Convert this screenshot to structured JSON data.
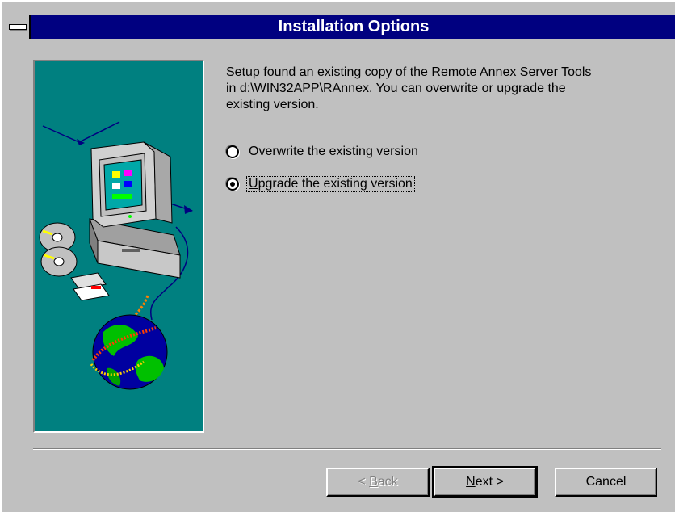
{
  "window": {
    "title": "Installation Options",
    "system_menu_icon": "system-menu-icon"
  },
  "illustration": {
    "icons": [
      "computer-icon",
      "cd-disc-icon",
      "floppy-disk-icon",
      "globe-icon",
      "network-cable-icon"
    ]
  },
  "message": {
    "line1": "Setup found an existing copy of the Remote Annex Server Tools",
    "line2": "in d:\\WIN32APP\\RAnnex. You can overwrite or upgrade the",
    "line3": "existing version."
  },
  "options": {
    "overwrite": {
      "label": "Overwrite the existing version",
      "selected": false
    },
    "upgrade_first_letter": "U",
    "upgrade_rest": "pgrade the existing version",
    "upgrade_selected": true
  },
  "buttons": {
    "back_prefix": "< ",
    "back_mnemonic": "B",
    "back_rest": "ack",
    "next_mnemonic": "N",
    "next_rest": "ext >",
    "cancel": "Cancel"
  },
  "colors": {
    "titlebar": "#000080",
    "face": "#c0c0c0",
    "bitmap_bg": "#008080"
  }
}
